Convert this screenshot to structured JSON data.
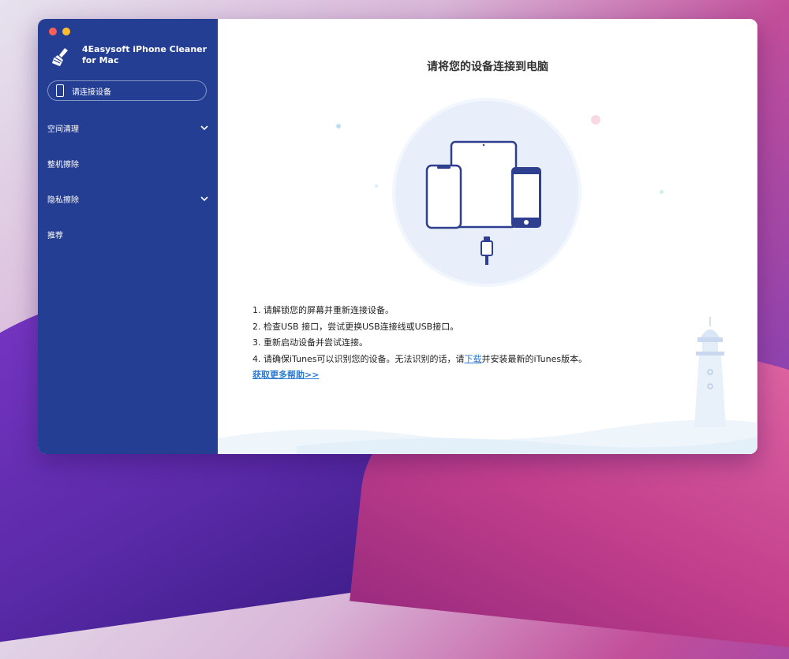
{
  "app": {
    "name": "4Easysoft iPhone Cleaner for Mac"
  },
  "sidebar": {
    "connect_button": "请连接设备",
    "items": [
      {
        "label": "空间清理",
        "has_chevron": true
      },
      {
        "label": "整机擦除",
        "has_chevron": false
      },
      {
        "label": "隐私擦除",
        "has_chevron": true
      },
      {
        "label": "推荐",
        "has_chevron": false
      }
    ]
  },
  "main": {
    "title": "请将您的设备连接到电脑",
    "steps": {
      "s1": "1. 请解锁您的屏幕并重新连接设备。",
      "s2": "2. 检查USB 接口，尝试更换USB连接线或USB接口。",
      "s3": "3. 重新启动设备并尝试连接。",
      "s4_pre": "4. 请确保iTunes可以识别您的设备。无法识别的话，请",
      "s4_link": "下载",
      "s4_post": "并安装最新的iTunes版本。"
    },
    "help_link": "获取更多帮助>>"
  },
  "icons": {
    "logo": "broom-cleaner-icon",
    "devices": "devices-illustration",
    "connector": "lightning-cable-icon",
    "chevron": "chevron-down-icon"
  },
  "colors": {
    "sidebar_bg": "#243e93",
    "accent": "#2a7ad6",
    "device_stroke": "#2e3f8f"
  }
}
